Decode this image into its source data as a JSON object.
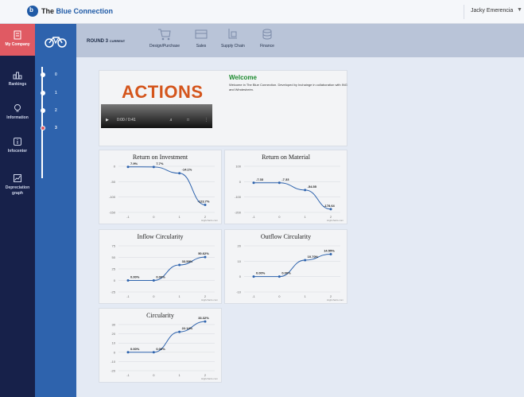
{
  "app": {
    "name_part1": "The ",
    "name_part2": "Blue Connection"
  },
  "user": {
    "name": "Jacky Emerencia",
    "menu_icon": "chevron-down-icon"
  },
  "sidebar": {
    "items": [
      {
        "label": "My Company",
        "icon": "building-icon",
        "active": true
      },
      {
        "label": "Rankings",
        "icon": "podium-icon"
      },
      {
        "label": "Information",
        "icon": "lightbulb-icon"
      },
      {
        "label": "Infocenter",
        "icon": "info-icon"
      },
      {
        "label": "Depreciation graph",
        "icon": "graph-icon"
      }
    ]
  },
  "timeline": {
    "steps": [
      "0",
      "1",
      "2",
      "3"
    ],
    "current": "3"
  },
  "round": {
    "label": "ROUND 3",
    "status": "CURRENT"
  },
  "nav": [
    "Design/Purchase",
    "Sales",
    "Supply Chain",
    "Finance"
  ],
  "welcome": {
    "actions_label": "ACTIONS",
    "video_time": "0:00 / 0:41",
    "title": "Welcome",
    "text": "Welcome in The Blue Connection. Developed by Inchainge in collaboration with ING and Windesheim."
  },
  "colors": {
    "line": "#2e63ad",
    "actions": "#d4551c",
    "welcome": "#1c8a2e",
    "active": "#e05a63"
  },
  "chart_data": [
    {
      "type": "line",
      "title": "Return on Investment",
      "credit": "Highcharts.com",
      "categories": [
        "-1",
        "0",
        "1",
        "2"
      ],
      "values": [
        7.9,
        7.7,
        -14.1,
        -123.7
      ],
      "labels": [
        "7.9%",
        "7.7%",
        "-14.1%",
        "-123.7%"
      ],
      "yticks": [
        "0",
        "-50",
        "-100",
        "-150"
      ],
      "ylim": [
        -150,
        10
      ]
    },
    {
      "type": "line",
      "title": "Return on Material",
      "credit": "Highcharts.com",
      "categories": [
        "-1",
        "0",
        "1",
        "2"
      ],
      "values": [
        -7.33,
        -7.33,
        -54.55,
        -178.64
      ],
      "labels": [
        "-7.33",
        "-7.33",
        "-54.55",
        "-178.64"
      ],
      "yticks": [
        "100",
        "0",
        "-100",
        "-200"
      ],
      "ylim": [
        -200,
        100
      ]
    },
    {
      "type": "line",
      "title": "Inflow Circularity",
      "credit": "Highcharts.com",
      "categories": [
        "-1",
        "0",
        "1",
        "2"
      ],
      "values": [
        0,
        0,
        33.59,
        50.62
      ],
      "labels": [
        "0.00%",
        "0.00%",
        "33.59%",
        "50.62%"
      ],
      "yticks": [
        "75",
        "50",
        "25",
        "0",
        "-25"
      ],
      "ylim": [
        -25,
        75
      ]
    },
    {
      "type": "line",
      "title": "Outflow Circularity",
      "credit": "Highcharts.com",
      "categories": [
        "-1",
        "0",
        "1",
        "2"
      ],
      "values": [
        0,
        0,
        10.7,
        14.55
      ],
      "labels": [
        "0.00%",
        "0.00%",
        "10.70%",
        "14.55%"
      ],
      "yticks": [
        "20",
        "10",
        "0",
        "-10"
      ],
      "ylim": [
        -10,
        20
      ]
    },
    {
      "type": "line",
      "title": "Circularity",
      "credit": "Highcharts.com",
      "categories": [
        "-1",
        "0",
        "1",
        "2"
      ],
      "values": [
        0,
        0,
        22.14,
        33.32
      ],
      "labels": [
        "0.00%",
        "0.00%",
        "22.14%",
        "33.32%"
      ],
      "yticks": [
        "30",
        "20",
        "10",
        "0",
        "-10",
        "-20"
      ],
      "ylim": [
        -20,
        30
      ]
    }
  ]
}
